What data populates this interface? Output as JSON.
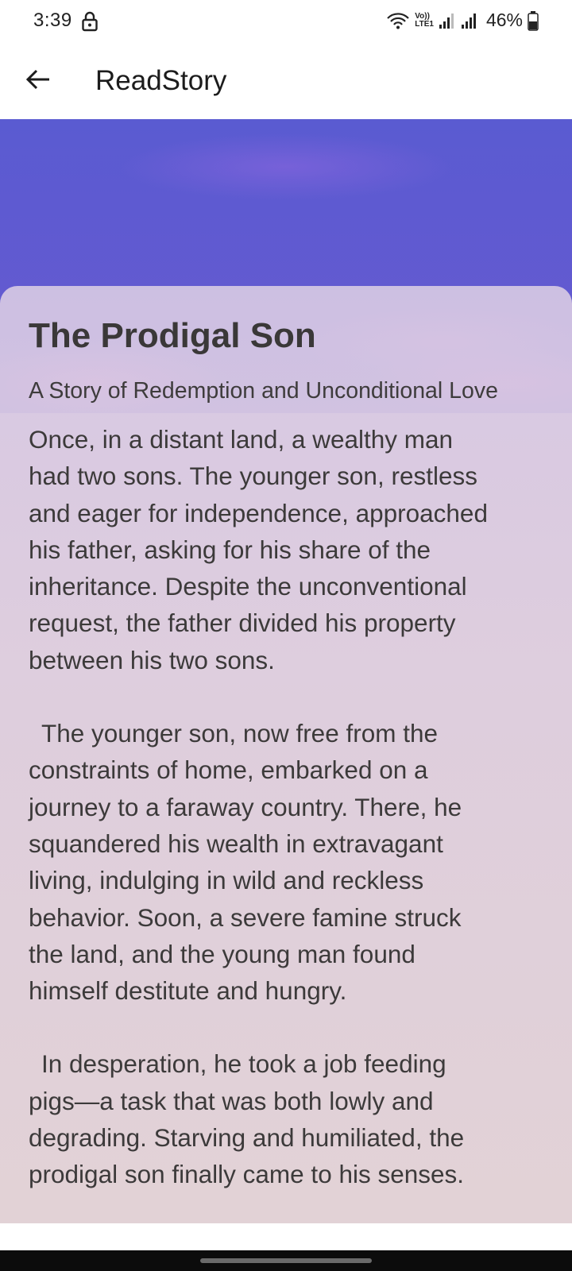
{
  "status_bar": {
    "time": "3:39",
    "battery": "46%",
    "network_label_top": "Vo))",
    "network_label_bottom": "LTE1",
    "icons": [
      "lock-icon",
      "wifi-icon",
      "signal-icon",
      "signal-icon",
      "battery-icon"
    ]
  },
  "app_bar": {
    "title": "ReadStory",
    "back_icon": "arrow-left-icon"
  },
  "story": {
    "title": "The Prodigal Son",
    "subtitle": "A Story of Redemption and Unconditional Love",
    "paragraphs": [
      {
        "lines": [
          "Once, in a distant land, a wealthy man",
          "had two sons. The younger son, restless",
          "and eager for independence, approached",
          "his father, asking for his share of the",
          "inheritance. Despite the unconventional",
          "request, the father divided his property",
          "between his two sons."
        ]
      },
      {
        "lines": [
          "The younger son, now free from the",
          "constraints of home, embarked on a",
          "journey to a faraway country. There, he",
          "squandered his wealth in extravagant",
          "living, indulging in wild and reckless",
          "behavior. Soon, a severe famine struck",
          "the land, and the young man found",
          "himself destitute and hungry."
        ]
      },
      {
        "lines": [
          "In desperation, he took a job feeding",
          "pigs—a task that was both lowly and",
          "degrading. Starving and humiliated, the",
          "prodigal son finally came to his senses."
        ]
      }
    ]
  }
}
